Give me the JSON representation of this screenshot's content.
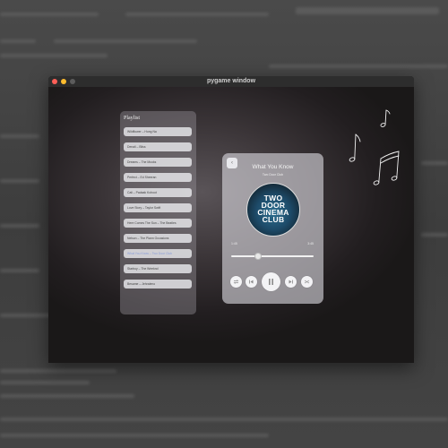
{
  "window": {
    "title": "pygame window"
  },
  "playlist": {
    "title": "Playlist",
    "items": [
      {
        "label": "Wildflower – Hung Na"
      },
      {
        "label": "Denali – Bliss"
      },
      {
        "label": "Dreams – The Mooks"
      },
      {
        "label": "Perfect – Ed Sheeran"
      },
      {
        "label": "Cali – Padaak Kohoot"
      },
      {
        "label": "Love Story – Taylor Swift"
      },
      {
        "label": "Here Comes The Sun – The Beatles"
      },
      {
        "label": "Nelson – The Plann Occasions"
      },
      {
        "label": "What You Know – Two Door Club"
      },
      {
        "label": "Starboy – The Weeknd"
      },
      {
        "label": "Besame – Jehraleno"
      }
    ],
    "active_index": 8
  },
  "player": {
    "back_icon": "chevron-left-icon",
    "song_title": "What You Know",
    "artist": "Two Door Club",
    "cover_text": "TWO DOOR CINEMA CLUB",
    "current_time": "1:45",
    "total_time": "3:45",
    "progress": 0.33,
    "controls": [
      "repeat-icon",
      "previous-icon",
      "pause-icon",
      "next-icon",
      "shuffle-icon"
    ]
  },
  "colors": {
    "close": "#fe5f57",
    "minimize": "#febc2e",
    "active_item_text": "#8a9ed8"
  }
}
